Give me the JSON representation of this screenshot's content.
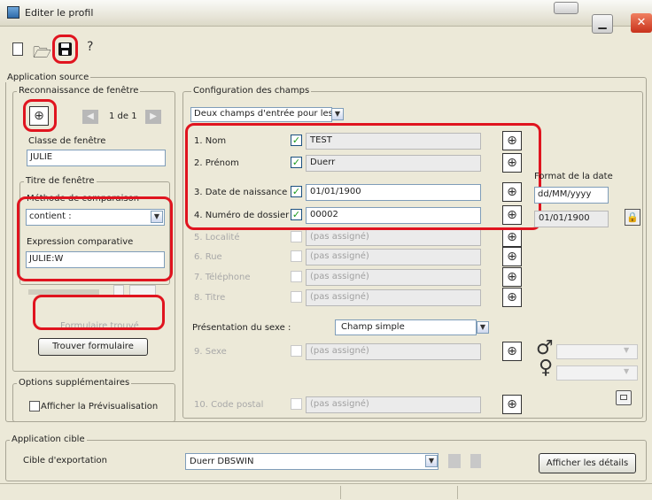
{
  "window": {
    "title": "Editer le profil"
  },
  "toolbar": {
    "help_label": "?"
  },
  "source": {
    "legend": "Application source",
    "recognition": {
      "legend": "Reconnaissance de fenêtre",
      "pager": "1 de 1",
      "class_label": "Classe de fenêtre",
      "class_value": "JULIE",
      "title_group": {
        "legend": "Titre de fenêtre",
        "method_label": "Méthode de comparaison",
        "method_value": "contient :",
        "expression_label": "Expression comparative",
        "expression_value": "JULIE:W"
      },
      "found_label": "Formulaire trouvé",
      "find_button": "Trouver formulaire"
    },
    "options": {
      "legend": "Options supplémentaires",
      "preview_label": "Afficher la Prévisualisation"
    },
    "fields_config": {
      "legend": "Configuration des champs",
      "mode_value": "Deux champs d'entrée pour les",
      "fields": [
        {
          "label": "1. Nom",
          "value": "TEST",
          "checked": true
        },
        {
          "label": "2. Prénom",
          "value": "Duerr",
          "checked": true
        },
        {
          "label": "3. Date de naissance",
          "value": "01/01/1900",
          "checked": true
        },
        {
          "label": "4. Numéro de dossier",
          "value": "00002",
          "checked": true
        },
        {
          "label": "5. Localité",
          "value": "(pas assigné)",
          "checked": false
        },
        {
          "label": "6. Rue",
          "value": "(pas assigné)",
          "checked": false
        },
        {
          "label": "7. Téléphone",
          "value": "(pas assigné)",
          "checked": false
        },
        {
          "label": "8. Titre",
          "value": "(pas assigné)",
          "checked": false
        }
      ],
      "date_format_label": "Format de la date",
      "date_format_value": "dd/MM/yyyy",
      "date_preview_value": "01/01/1900",
      "sex_presentation_label": "Présentation du sexe :",
      "sex_presentation_value": "Champ simple",
      "sex_field": {
        "label": "9. Sexe",
        "value": "(pas assigné)"
      },
      "postal_field": {
        "label": "10. Code postal",
        "value": "(pas assigné)"
      },
      "male_symbol": "♂",
      "female_symbol": "♀"
    }
  },
  "target": {
    "legend": "Application cible",
    "export_label": "Cible d'exportation",
    "export_value": "Duerr DBSWIN",
    "details_button": "Afficher les détails"
  }
}
